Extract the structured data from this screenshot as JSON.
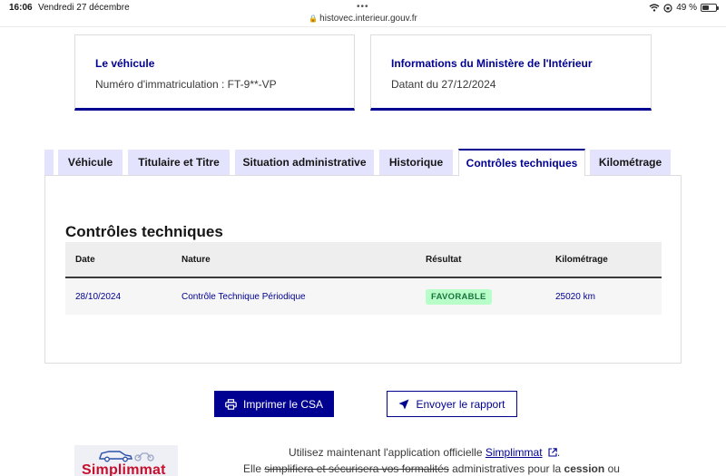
{
  "status_bar": {
    "time": "16:06",
    "date": "Vendredi 27 décembre",
    "dots": "•••",
    "url": "histovec.interieur.gouv.fr",
    "battery": "49 %",
    "battery_level": 0.49
  },
  "cards": {
    "vehicle": {
      "title": "Le véhicule",
      "text": "Numéro d'immatriculation : FT-9**-VP"
    },
    "ministry": {
      "title": "Informations du Ministère de l'Intérieur",
      "text": "Datant du 27/12/2024"
    }
  },
  "tabs": [
    {
      "label": "Véhicule"
    },
    {
      "label": "Titulaire et Titre"
    },
    {
      "label": "Situation administrative"
    },
    {
      "label": "Historique"
    },
    {
      "label": "Contrôles techniques",
      "active": true
    },
    {
      "label": "Kilométrage"
    }
  ],
  "panel": {
    "title": "Contrôles techniques",
    "columns": [
      "Date",
      "Nature",
      "Résultat",
      "Kilométrage"
    ],
    "rows": [
      {
        "date": "28/10/2024",
        "nature": "Contrôle Technique Périodique",
        "result": "FAVORABLE",
        "km": "25020 km"
      }
    ]
  },
  "buttons": {
    "print": "Imprimer le CSA",
    "send": "Envoyer le rapport"
  },
  "promo": {
    "logo_text": "Simplimmat",
    "line1_prefix": "Utilisez maintenant l'application officielle",
    "line1_link": "Simplimmat",
    "line1_suffix": ".",
    "line2_prefix": "Elle",
    "line2_struck": "simplifiera et sécurisera vos formalités",
    "line2_mid": "administratives pour la",
    "line2_bold": "cession",
    "line2_suffix": "ou"
  },
  "colors": {
    "accent": "#000091",
    "tab_bg": "#e3e3fd",
    "badge_bg": "#b8fec9",
    "badge_text": "#18753c"
  }
}
